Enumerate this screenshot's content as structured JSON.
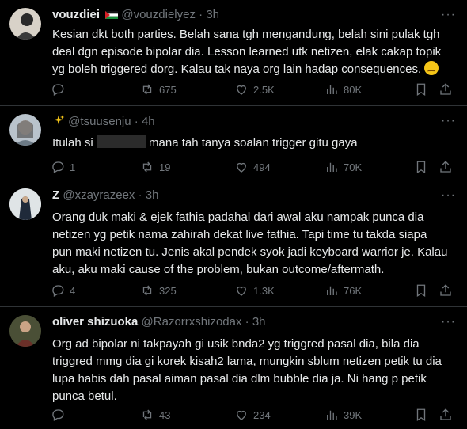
{
  "tweets": [
    {
      "name": "vouzdiei",
      "handle": "@vouzdielyez",
      "time": "3h",
      "text": "Kesian dkt both parties. Belah sana tgh mengandung, belah sini pulak tgh deal dgn episode bipolar dia. Lesson learned utk netizen, elak cakap topik yg boleh triggered dorg. Kalau tak naya org lain hadap consequences.",
      "replies": "",
      "retweets": "675",
      "likes": "2.5K",
      "views": "80K"
    },
    {
      "name": "",
      "handle": "@tsuusenju",
      "time": "4h",
      "text_before": "Itulah si",
      "text_after": "mana tah tanya soalan trigger gitu gaya",
      "replies": "1",
      "retweets": "19",
      "likes": "494",
      "views": "70K"
    },
    {
      "name": "Z",
      "handle": "@xzayrazeex",
      "time": "3h",
      "text": "Orang duk maki & ejek fathia padahal dari awal aku nampak punca dia netizen yg petik nama zahirah dekat live fathia. Tapi time tu takda siapa pun maki netizen tu. Jenis akal pendek syok jadi keyboard warrior je. Kalau aku, aku maki cause of the problem, bukan outcome/aftermath.",
      "replies": "4",
      "retweets": "325",
      "likes": "1.3K",
      "views": "76K"
    },
    {
      "name": "oliver shizuoka",
      "handle": "@Razorrxshizodax",
      "time": "3h",
      "text": "Org ad bipolar ni takpayah gi usik bnda2 yg triggred pasal dia, bila dia triggred mmg dia gi korek kisah2 lama, mungkin sblum netizen petik tu dia lupa habis dah pasal aiman pasal dia dlm bubble dia ja. Ni hang p petik punca betul.",
      "replies": "",
      "retweets": "43",
      "likes": "234",
      "views": "39K"
    }
  ],
  "separator": "·",
  "more": "···",
  "colors": {
    "background": "#000000",
    "text": "#e7e9ea",
    "muted": "#71767b",
    "border": "#2f3336"
  },
  "icons": [
    "reply-icon",
    "retweet-icon",
    "like-icon",
    "views-icon",
    "bookmark-icon",
    "share-icon",
    "sparkles-icon",
    "flag-icon",
    "emoji-icon"
  ]
}
